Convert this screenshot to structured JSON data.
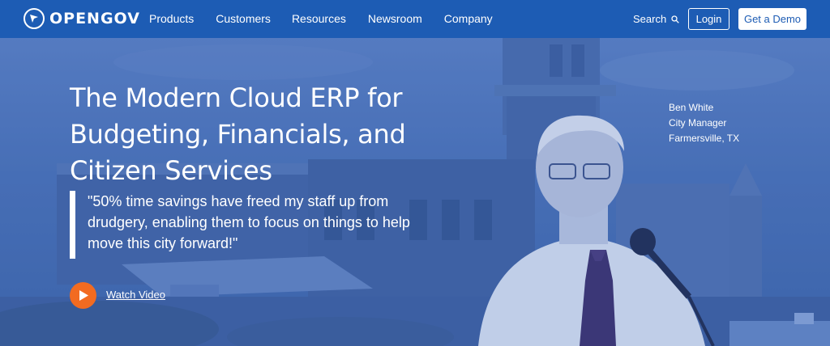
{
  "nav": {
    "logo_text": "OPENGOV",
    "items": [
      {
        "label": "Products"
      },
      {
        "label": "Customers"
      },
      {
        "label": "Resources"
      },
      {
        "label": "Newsroom"
      },
      {
        "label": "Company"
      }
    ],
    "search_label": "Search",
    "login_label": "Login",
    "demo_label": "Get a Demo"
  },
  "hero": {
    "title": "The Modern Cloud ERP for Budgeting, Financials, and Citizen Services",
    "quote": "\"50% time savings have freed my staff up from drudgery, enabling them to focus on things to help move this city forward!\"",
    "watch_label": "Watch Video",
    "attribution": {
      "name": "Ben White",
      "role": "City Manager",
      "location": "Farmersville, TX"
    }
  },
  "colors": {
    "nav_bg": "#1d5cb4",
    "hero_overlay": "#4a71b8",
    "play_accent": "#f26b21"
  },
  "icons": [
    "opengov-logo-icon",
    "search-icon",
    "play-icon"
  ]
}
